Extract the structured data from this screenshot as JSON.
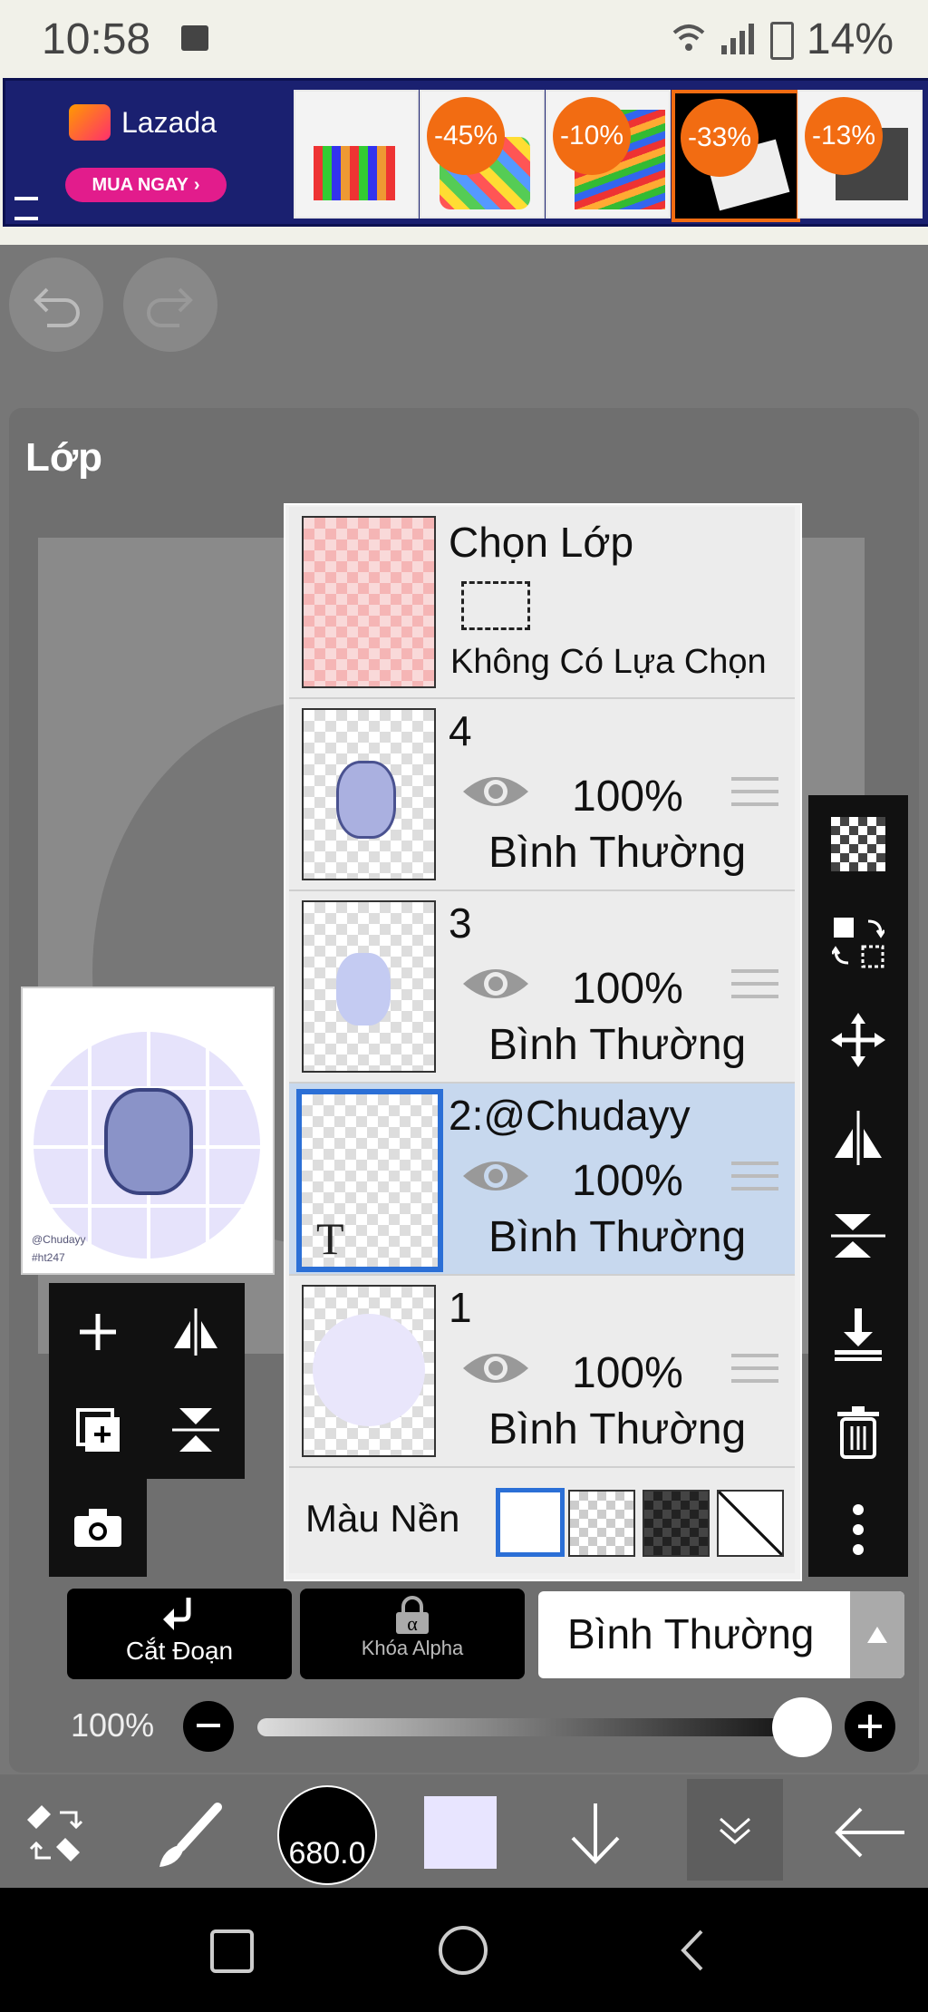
{
  "status_bar": {
    "time": "10:58",
    "battery": "14%"
  },
  "ad": {
    "brand": "Lazada",
    "cta": "MUA NGAY",
    "discounts": [
      "-45%",
      "-10%",
      "-33%",
      "-13%"
    ]
  },
  "panel": {
    "title": "Lớp"
  },
  "selection_layer": {
    "title": "Chọn Lớp",
    "subtitle": "Không Có Lựa Chọn"
  },
  "layers": [
    {
      "name": "4",
      "opacity": "100%",
      "blend": "Bình Thường"
    },
    {
      "name": "3",
      "opacity": "100%",
      "blend": "Bình Thường"
    },
    {
      "name": "2:@Chudayy",
      "opacity": "100%",
      "blend": "Bình Thường",
      "text_marker": "T"
    },
    {
      "name": "1",
      "opacity": "100%",
      "blend": "Bình Thường"
    }
  ],
  "background": {
    "label": "Màu Nền"
  },
  "preview": {
    "credit_1": "@Chudayy",
    "credit_2": "#ht247"
  },
  "controls": {
    "clip_label": "Cắt Đoạn",
    "alpha_lock_label": "Khóa Alpha",
    "blend_mode": "Bình Thường",
    "opacity": "100%"
  },
  "bottom_bar": {
    "brush_size": "680.0"
  },
  "colors": {
    "accent": "#2b6fd6",
    "current_color": "#e8e5ff",
    "ad_orange": "#f26c12"
  }
}
